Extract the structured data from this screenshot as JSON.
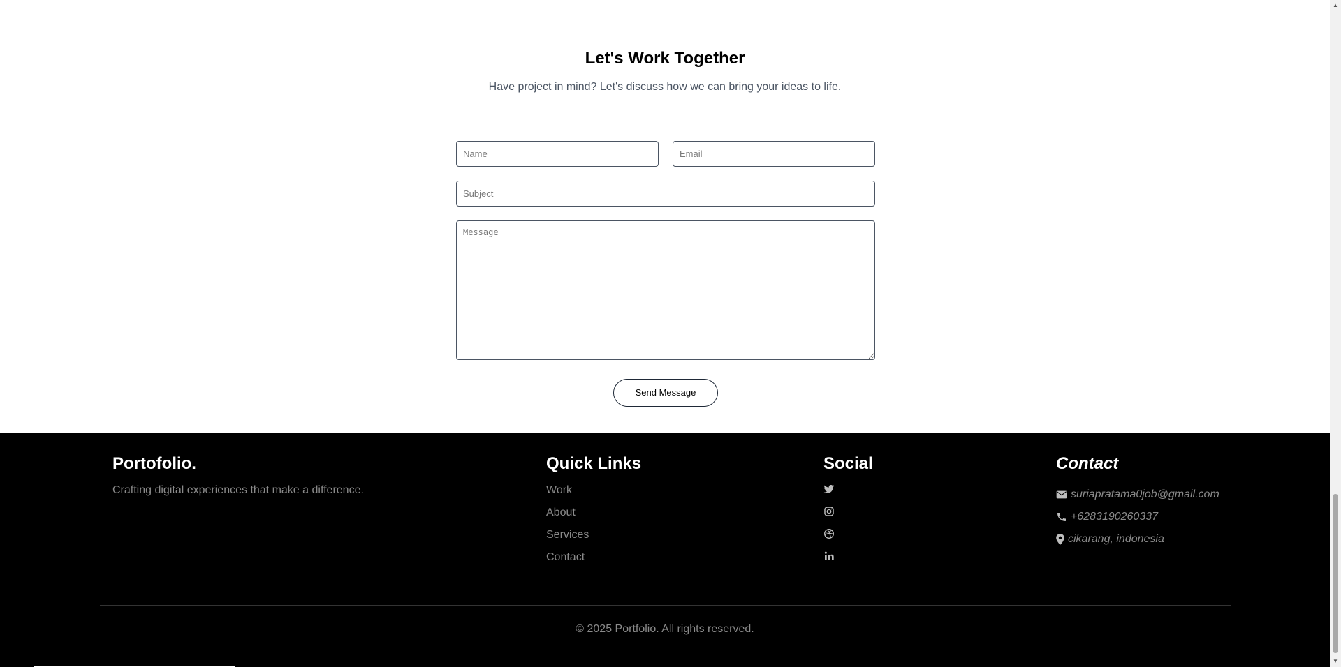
{
  "contact": {
    "title": "Let's Work Together",
    "subtitle": "Have project in mind? Let's discuss how we can bring your ideas to life.",
    "name_placeholder": "Name",
    "email_placeholder": "Email",
    "subject_placeholder": "Subject",
    "message_placeholder": "Message",
    "send_label": "Send Message"
  },
  "footer": {
    "brand": {
      "title": "Portofolio.",
      "tagline": "Crafting digital experiences that make a difference."
    },
    "quick_links": {
      "heading": "Quick Links",
      "items": [
        "Work",
        "About",
        "Services",
        "Contact"
      ]
    },
    "social": {
      "heading": "Social",
      "icons": [
        "twitter-icon",
        "instagram-icon",
        "dribbble-icon",
        "linkedin-icon"
      ]
    },
    "contact": {
      "heading": "Contact",
      "email": "suriapratama0job@gmail.com",
      "phone": "+6283190260337",
      "location": "cikarang, indonesia"
    },
    "copyright": "© 2025 Portfolio. All rights reserved."
  },
  "colors": {
    "footer_bg": "#000000",
    "muted_text": "#8a8a8a",
    "subtitle_text": "#4b5563"
  }
}
